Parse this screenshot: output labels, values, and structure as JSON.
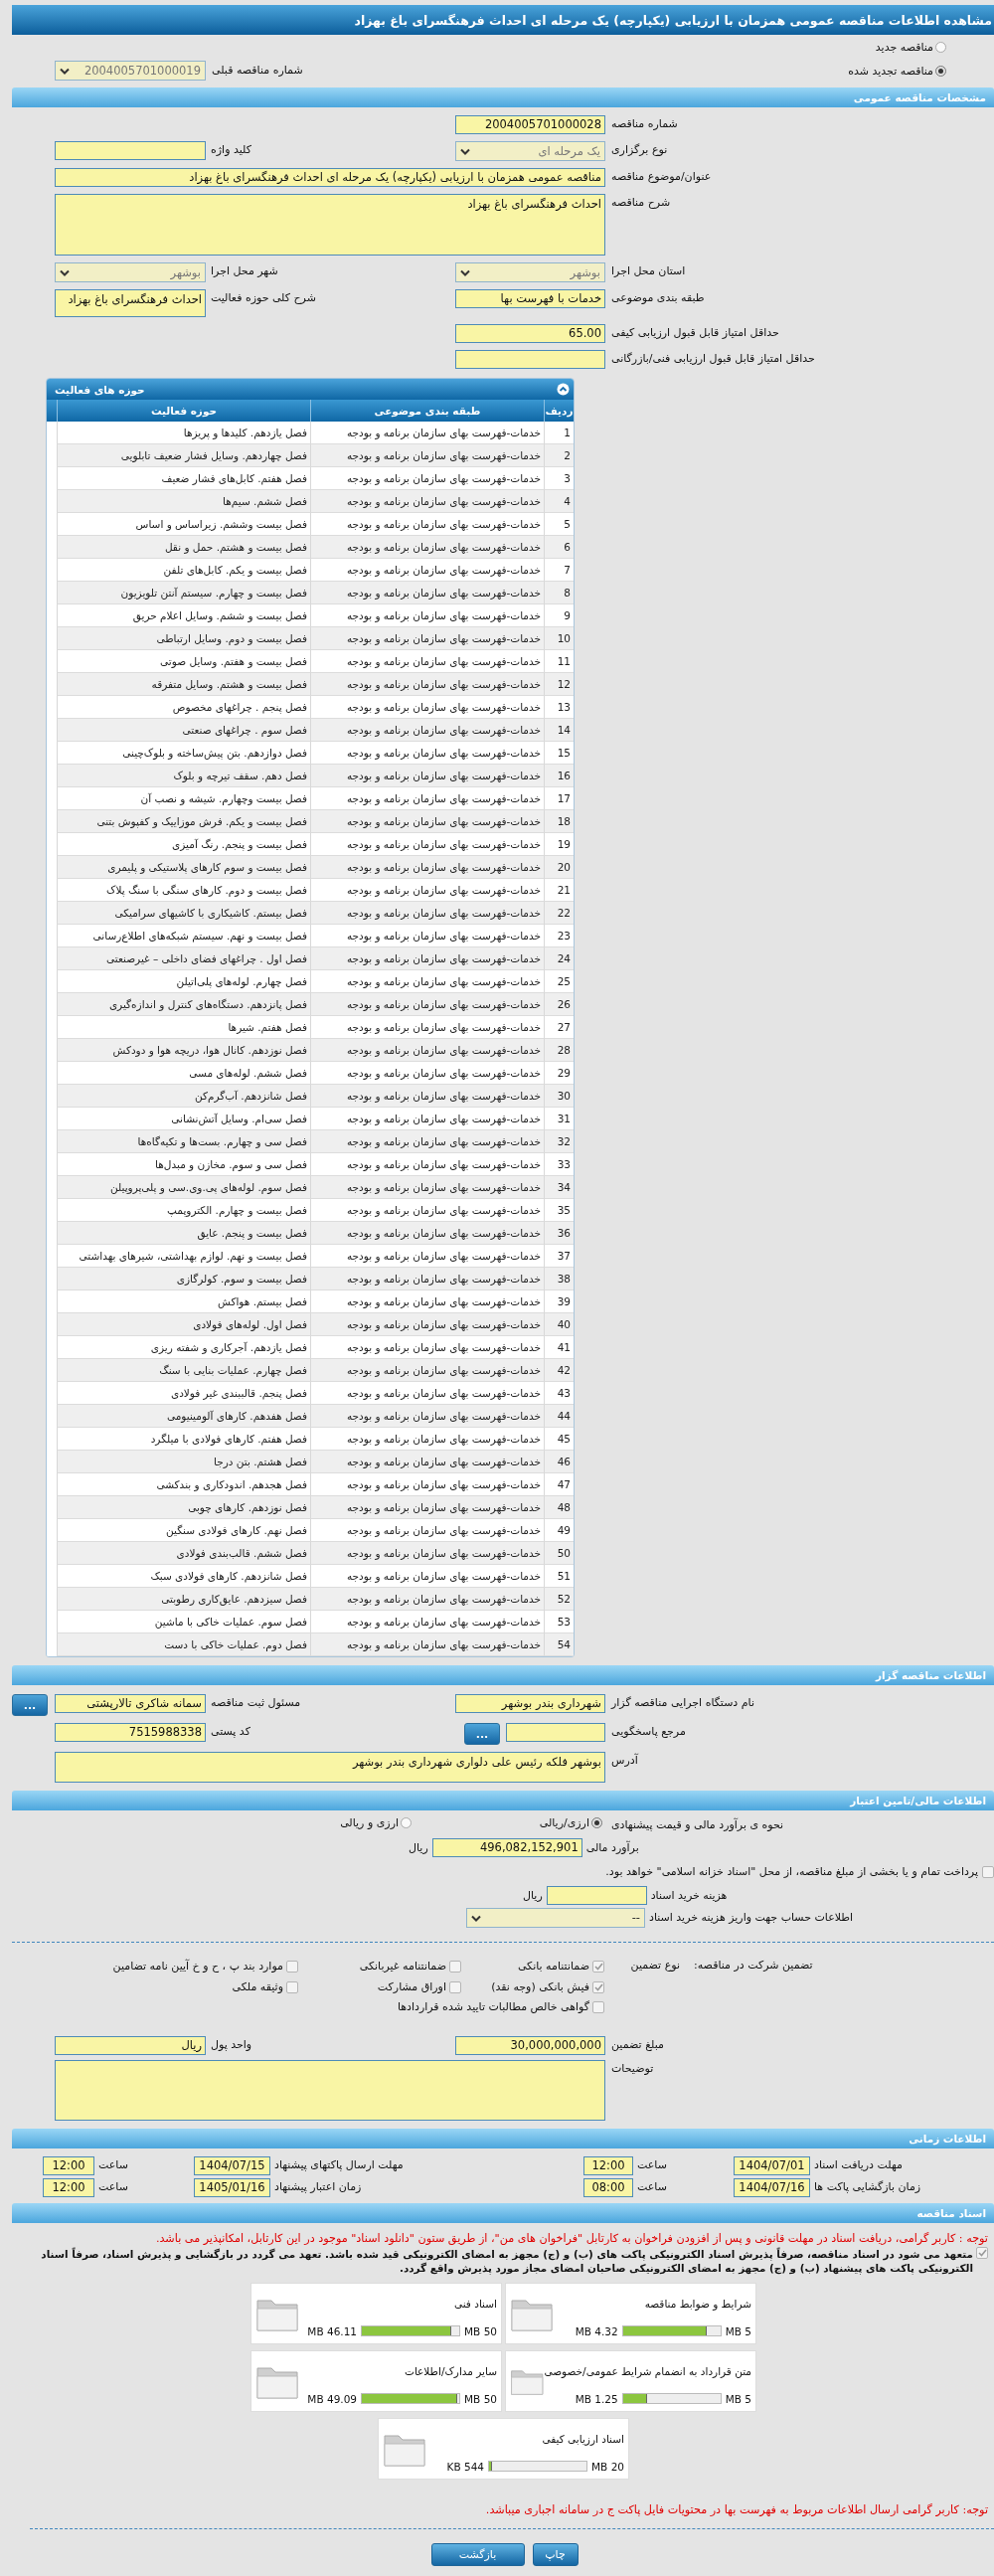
{
  "title": "مشاهده اطلاعات مناقصه عمومی همزمان با ارزیابی (یکپارچه) یک مرحله ای احداث فرهنگسرای باغ بهزاد",
  "tender_status": [
    {
      "label": "مناقصه جدید",
      "selected": false
    },
    {
      "label": "مناقصه تجدید شده",
      "selected": true
    }
  ],
  "previous_tender": {
    "label": "شماره مناقصه قبلی",
    "value": "2004005701000019"
  },
  "general": {
    "title": "مشخصات مناقصه عمومی",
    "rows": [
      {
        "right": {
          "label": "شماره مناقصه",
          "value": "2004005701000028",
          "kind": "input"
        }
      },
      {
        "right": {
          "label": "نوع برگزاری",
          "value": "یک مرحله ای",
          "kind": "select"
        },
        "left": {
          "label": "کلید واژه",
          "kind": "input"
        }
      },
      {
        "right": {
          "label": "عنوان/موضوع مناقصه",
          "value": "مناقصه عمومی همزمان با ارزیابی (یکپارچه) یک مرحله ای احداث فرهنگسرای باغ بهزاد",
          "kind": "wide_input"
        }
      },
      {
        "right": {
          "label": "شرح مناقصه",
          "value": "احداث فرهنگسرای باغ بهزاد",
          "kind": "wide_area"
        }
      },
      {
        "right": {
          "label": "استان محل اجرا",
          "value": "بوشهر",
          "kind": "select"
        },
        "left": {
          "label": "شهر محل اجرا",
          "value": "بوشهر",
          "kind": "select"
        }
      },
      {
        "right": {
          "label": "طبقه بندی موضوعی",
          "value": "خدمات با فهرست بها",
          "kind": "input"
        },
        "left": {
          "label": "شرح کلی حوزه فعالیت",
          "value": "احداث فرهنگسرای باغ بهزاد",
          "kind": "text_area"
        }
      },
      {
        "right": {
          "label": "حداقل امتیاز قابل قبول ارزیابی کیفی",
          "value": "65.00",
          "kind": "input"
        }
      },
      {
        "right": {
          "label": "حداقل امتیاز قابل قبول ارزیابی فنی/بازرگانی",
          "kind": "input"
        }
      }
    ]
  },
  "activities": {
    "title": "حوزه های فعالیت",
    "columns": [
      "ردیف",
      "طبقه بندی موضوعی",
      "حوزه فعالیت"
    ],
    "rows": [
      {
        "n": "1",
        "category": "خدمات-فهرست بهای سازمان برنامه و بودجه",
        "activity": "فصل یازدهم. کلیدها و پریزها"
      },
      {
        "n": "2",
        "category": "خدمات-فهرست بهای سازمان برنامه و بودجه",
        "activity": "فصل چهاردهم. وسایل فشار ضعیف تابلویی"
      },
      {
        "n": "3",
        "category": "خدمات-فهرست بهای سازمان برنامه و بودجه",
        "activity": "فصل هفتم. کابل‌های فشار ضعیف"
      },
      {
        "n": "4",
        "category": "خدمات-فهرست بهای سازمان برنامه و بودجه",
        "activity": "فصل ششم. سیم‌ها"
      },
      {
        "n": "5",
        "category": "خدمات-فهرست بهای سازمان برنامه و بودجه",
        "activity": "فصل بیست وششم. زیراساس و اساس"
      },
      {
        "n": "6",
        "category": "خدمات-فهرست بهای سازمان برنامه و بودجه",
        "activity": "فصل بیست و هشتم. حمل و نقل"
      },
      {
        "n": "7",
        "category": "خدمات-فهرست بهای سازمان برنامه و بودجه",
        "activity": "فصل بیست و یکم. کابل‌های تلفن"
      },
      {
        "n": "8",
        "category": "خدمات-فهرست بهای سازمان برنامه و بودجه",
        "activity": "فصل بیست و چهارم. سیستم آنتن تلویزیون"
      },
      {
        "n": "9",
        "category": "خدمات-فهرست بهای سازمان برنامه و بودجه",
        "activity": "فصل بیست و ششم. وسایل اعلام حریق"
      },
      {
        "n": "10",
        "category": "خدمات-فهرست بهای سازمان برنامه و بودجه",
        "activity": "فصل بیست و دوم. وسایل ارتباطی"
      },
      {
        "n": "11",
        "category": "خدمات-فهرست بهای سازمان برنامه و بودجه",
        "activity": "فصل بیست و هفتم. وسایل صوتی"
      },
      {
        "n": "12",
        "category": "خدمات-فهرست بهای سازمان برنامه و بودجه",
        "activity": "فصل بیست و هشتم. وسایل متفرقه"
      },
      {
        "n": "13",
        "category": "خدمات-فهرست بهای سازمان برنامه و بودجه",
        "activity": "فصل پنجم . چراغهای مخصوص"
      },
      {
        "n": "14",
        "category": "خدمات-فهرست بهای سازمان برنامه و بودجه",
        "activity": "فصل سوم . چراغهای صنعتی"
      },
      {
        "n": "15",
        "category": "خدمات-فهرست بهای سازمان برنامه و بودجه",
        "activity": "فصل دوازدهم. بتن پیش‌ساخته و بلوک‌چینی"
      },
      {
        "n": "16",
        "category": "خدمات-فهرست بهای سازمان برنامه و بودجه",
        "activity": "فصل دهم. سقف تیرچه و بلوک"
      },
      {
        "n": "17",
        "category": "خدمات-فهرست بهای سازمان برنامه و بودجه",
        "activity": "فصل بیست وچهارم. شیشه و نصب آن"
      },
      {
        "n": "18",
        "category": "خدمات-فهرست بهای سازمان برنامه و بودجه",
        "activity": "فصل بیست و یکم. فرش موزاییک و کفپوش بتنی"
      },
      {
        "n": "19",
        "category": "خدمات-فهرست بهای سازمان برنامه و بودجه",
        "activity": "فصل بیست و پنجم. رنگ آمیزی"
      },
      {
        "n": "20",
        "category": "خدمات-فهرست بهای سازمان برنامه و بودجه",
        "activity": "فصل بیست و سوم کارهای پلاستیکی و پلیمری"
      },
      {
        "n": "21",
        "category": "خدمات-فهرست بهای سازمان برنامه و بودجه",
        "activity": "فصل بیست و دوم. کارهای سنگی با سنگ پلاک"
      },
      {
        "n": "22",
        "category": "خدمات-فهرست بهای سازمان برنامه و بودجه",
        "activity": "فصل بیستم. کاشیکاری با کاشیهای سرامیکی"
      },
      {
        "n": "23",
        "category": "خدمات-فهرست بهای سازمان برنامه و بودجه",
        "activity": "فصل بیست و نهم. سیستم شبکه‌های اطلاع‌رسانی"
      },
      {
        "n": "24",
        "category": "خدمات-فهرست بهای سازمان برنامه و بودجه",
        "activity": "فصل اول . چراغهای فضای داخلی – غیرصنعتی"
      },
      {
        "n": "25",
        "category": "خدمات-فهرست بهای سازمان برنامه و بودجه",
        "activity": "فصل چهارم. لوله‌های پلی‌اتیلن"
      },
      {
        "n": "26",
        "category": "خدمات-فهرست بهای سازمان برنامه و بودجه",
        "activity": "فصل پانزدهم. دستگاه‌های کنترل و اندازه‌گیری"
      },
      {
        "n": "27",
        "category": "خدمات-فهرست بهای سازمان برنامه و بودجه",
        "activity": "فصل هفتم. شیرها"
      },
      {
        "n": "28",
        "category": "خدمات-فهرست بهای سازمان برنامه و بودجه",
        "activity": "فصل نوزدهم. کانال هوا، دریچه هوا و دودکش"
      },
      {
        "n": "29",
        "category": "خدمات-فهرست بهای سازمان برنامه و بودجه",
        "activity": "فصل ششم. لوله‌های مسی"
      },
      {
        "n": "30",
        "category": "خدمات-فهرست بهای سازمان برنامه و بودجه",
        "activity": "فصل شانزدهم. آب‌گرم‌کن"
      },
      {
        "n": "31",
        "category": "خدمات-فهرست بهای سازمان برنامه و بودجه",
        "activity": "فصل سی‌ام. وسایل آتش‌نشانی"
      },
      {
        "n": "32",
        "category": "خدمات-فهرست بهای سازمان برنامه و بودجه",
        "activity": "فصل سی و چهارم. بست‌ها و تکیه‌گاه‌ها"
      },
      {
        "n": "33",
        "category": "خدمات-فهرست بهای سازمان برنامه و بودجه",
        "activity": "فصل سی و سوم. مخازن و مبدل‌ها"
      },
      {
        "n": "34",
        "category": "خدمات-فهرست بهای سازمان برنامه و بودجه",
        "activity": "فصل سوم. لوله‌های پی.وی.سی و پلی‌پروپیلن"
      },
      {
        "n": "35",
        "category": "خدمات-فهرست بهای سازمان برنامه و بودجه",
        "activity": "فصل بیست و چهارم. الکتروپمپ"
      },
      {
        "n": "36",
        "category": "خدمات-فهرست بهای سازمان برنامه و بودجه",
        "activity": "فصل بیست و پنجم. عایق"
      },
      {
        "n": "37",
        "category": "خدمات-فهرست بهای سازمان برنامه و بودجه",
        "activity": "فصل بیست و نهم. لوازم بهداشتی، شیرهای بهداشتی"
      },
      {
        "n": "38",
        "category": "خدمات-فهرست بهای سازمان برنامه و بودجه",
        "activity": "فصل بیست و سوم. کولرگازی"
      },
      {
        "n": "39",
        "category": "خدمات-فهرست بهای سازمان برنامه و بودجه",
        "activity": "فصل بیستم. هواکش"
      },
      {
        "n": "40",
        "category": "خدمات-فهرست بهای سازمان برنامه و بودجه",
        "activity": "فصل اول. لوله‌های فولادی"
      },
      {
        "n": "41",
        "category": "خدمات-فهرست بهای سازمان برنامه و بودجه",
        "activity": "فصل یازدهم. آجرکاری و شفته ریزی"
      },
      {
        "n": "42",
        "category": "خدمات-فهرست بهای سازمان برنامه و بودجه",
        "activity": "فصل چهارم. عملیات بنایی با سنگ"
      },
      {
        "n": "43",
        "category": "خدمات-فهرست بهای سازمان برنامه و بودجه",
        "activity": "فصل پنجم. قالببندی غیر فولادی"
      },
      {
        "n": "44",
        "category": "خدمات-فهرست بهای سازمان برنامه و بودجه",
        "activity": "فصل هفدهم. کارهای آلومینیومی"
      },
      {
        "n": "45",
        "category": "خدمات-فهرست بهای سازمان برنامه و بودجه",
        "activity": "فصل هفتم. کارهای فولادی با میلگرد"
      },
      {
        "n": "46",
        "category": "خدمات-فهرست بهای سازمان برنامه و بودجه",
        "activity": "فصل هشتم. بتن درجا"
      },
      {
        "n": "47",
        "category": "خدمات-فهرست بهای سازمان برنامه و بودجه",
        "activity": "فصل هجدهم. اندودکاری و بندکشی"
      },
      {
        "n": "48",
        "category": "خدمات-فهرست بهای سازمان برنامه و بودجه",
        "activity": "فصل نوزدهم. کارهای چوبی"
      },
      {
        "n": "49",
        "category": "خدمات-فهرست بهای سازمان برنامه و بودجه",
        "activity": "فصل نهم. کارهای فولادی سنگین"
      },
      {
        "n": "50",
        "category": "خدمات-فهرست بهای سازمان برنامه و بودجه",
        "activity": "فصل ششم. قالب‌بندی فولادی"
      },
      {
        "n": "51",
        "category": "خدمات-فهرست بهای سازمان برنامه و بودجه",
        "activity": "فصل شانزدهم. کارهای فولادی سبک"
      },
      {
        "n": "52",
        "category": "خدمات-فهرست بهای سازمان برنامه و بودجه",
        "activity": "فصل سیزدهم. عایق‌کاری رطوبتی"
      },
      {
        "n": "53",
        "category": "خدمات-فهرست بهای سازمان برنامه و بودجه",
        "activity": "فصل سوم. عملیات خاکی با ماشین"
      },
      {
        "n": "54",
        "category": "خدمات-فهرست بهای سازمان برنامه و بودجه",
        "activity": "فصل دوم. عملیات خاکی با دست"
      }
    ]
  },
  "contractor": {
    "title": "اطلاعات مناقصه گزار",
    "rows": [
      {
        "right": {
          "label": "نام دستگاه اجرایی مناقصه گزار",
          "value": "شهرداری بندر بوشهر",
          "kind": "input"
        },
        "left": {
          "label": "مسئول ثبت مناقصه",
          "value": "سمانه شاکری تالارپشتی",
          "kind": "input",
          "button": "..."
        }
      },
      {
        "right": {
          "label": "مرجع پاسخگویی",
          "kind": "input",
          "button": "..."
        },
        "left": {
          "label": "کد پستی",
          "value": "7515988338",
          "kind": "input"
        }
      },
      {
        "right": {
          "label": "آدرس",
          "value": "بوشهر فلکه رئیس علی دلواری شهرداری بندر بوشهر",
          "kind": "wide_area"
        }
      }
    ]
  },
  "financial": {
    "title": "اطلاعات مالی/تامین اعتبار",
    "method": {
      "label": "نحوه ی برآورد مالی و قیمت پیشنهادی",
      "options": [
        {
          "label": "ارزی/ریالی",
          "selected": true
        },
        {
          "label": "ارزی و ریالی",
          "selected": false
        }
      ]
    },
    "estimate": {
      "label": "برآورد مالی",
      "value": "496,082,152,901",
      "unit": "ریال"
    },
    "treasury": {
      "label": "پرداخت تمام و یا بخشی از مبلغ مناقصه، از محل \"اسناد خزانه اسلامی\" خواهد بود.",
      "checked": false
    },
    "document_cost": {
      "label": "هزینه خرید اسناد",
      "unit": "ریال"
    },
    "account": {
      "label": "اطلاعات حساب جهت واریز هزینه خرید اسناد",
      "value": "--"
    },
    "guarantee": {
      "title": "تضمین شرکت در مناقصه:",
      "type_label": "نوع تضمین",
      "options": [
        {
          "label": "ضمانتنامه بانکی",
          "checked": true
        },
        {
          "label": "ضمانتنامه غیربانکی",
          "checked": false
        },
        {
          "label": "موارد بند پ ، ح و خ آیین نامه تضامین",
          "checked": false
        },
        {
          "label": "فیش بانکی (وجه نقد)",
          "checked": true
        },
        {
          "label": "اوراق مشارکت",
          "checked": false
        },
        {
          "label": "وثیقه ملکی",
          "checked": false
        },
        {
          "label": "گواهی خالص مطالبات تایید شده قراردادها",
          "checked": false
        }
      ]
    },
    "rows": [
      {
        "right": {
          "label": "مبلغ تضمین",
          "value": "30,000,000,000",
          "kind": "input"
        },
        "left": {
          "label": "واحد پول",
          "value": "ریال",
          "kind": "input"
        }
      },
      {
        "right": {
          "label": "توضیحات",
          "kind": "wide_area"
        }
      }
    ]
  },
  "schedule": {
    "title": "اطلاعات زمانی",
    "items": [
      {
        "label": "مهلت دریافت اسناد",
        "date": "1404/07/01",
        "time_label": "ساعت",
        "time": "12:00"
      },
      {
        "label": "مهلت ارسال پاکتهای پیشنهاد",
        "date": "1404/07/15",
        "time_label": "ساعت",
        "time": "12:00"
      },
      {
        "label": "زمان بازگشایی پاکت ها",
        "date": "1404/07/16",
        "time_label": "ساعت",
        "time": "08:00"
      },
      {
        "label": "زمان اعتبار پیشنهاد",
        "date": "1405/01/16",
        "time_label": "ساعت",
        "time": "12:00"
      }
    ]
  },
  "documents": {
    "title": "اسناد مناقصه",
    "notice": "توجه : کاربر گرامی، دریافت اسناد در مهلت قانونی و پس از افزودن فراخوان به کارتابل \"فراخوان های من\"، از طریق ستون \"دانلود اسناد\" موجود در این کارتابل، امکانپذیر می باشد.",
    "pledge": {
      "text": "متعهد می شود در اسناد مناقصه، صرفاً پذیرش اسناد الکترونیکی پاکت های (ب) و (ج) مجهز به امضای الکترونیکی قید شده باشد. تعهد می گردد در بازگشایی و پذیرش اسناد، صرفاً اسناد الکترونیکی پاکت های پیشنهاد (ب) و (ج) مجهز به امضای الکترونیکی صاحبان امضای مجاز مورد پذیرش واقع گردد.",
      "checked": true
    },
    "files": [
      {
        "name": "شرایط و ضوابط مناقصه",
        "used": "4.32 MB",
        "max": "5 MB",
        "level": 0.864
      },
      {
        "name": "اسناد فنی",
        "used": "46.11 MB",
        "max": "50 MB",
        "level": 0.922
      },
      {
        "name": "متن قرارداد به انضمام شرایط عمومی/خصوصی",
        "used": "1.25 MB",
        "max": "5 MB",
        "level": 0.25
      },
      {
        "name": "سایر مدارک/اطلاعات",
        "used": "49.09 MB",
        "max": "50 MB",
        "level": 0.982
      },
      {
        "name": "اسناد ارزیابی کیفی",
        "used": "544 KB",
        "max": "20 MB",
        "level": 0.027
      }
    ],
    "footer_notice": "توجه: کاربر گرامی ارسال اطلاعات مربوط به فهرست بها در محتویات فایل پاکت ج در سامانه اجباری میباشد."
  },
  "buttons": [
    "چاپ",
    "بازگشت"
  ]
}
